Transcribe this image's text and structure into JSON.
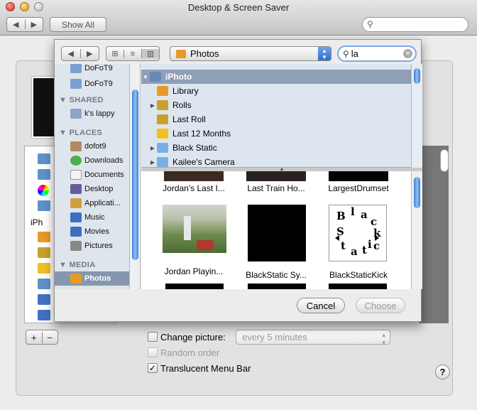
{
  "window": {
    "title": "Desktop & Screen Saver",
    "show_all_label": "Show All"
  },
  "sheet": {
    "location_label": "Photos",
    "search_value": "la",
    "sidebar": {
      "top_items": [
        "DoFoT9",
        "DoFoT9"
      ],
      "shared_header": "SHARED",
      "shared_items": [
        "k's lappy"
      ],
      "places_header": "PLACES",
      "places_items": [
        "dofot9",
        "Downloads",
        "Documents",
        "Desktop",
        "Applicati...",
        "Music",
        "Movies",
        "Pictures"
      ],
      "media_header": "MEDIA",
      "media_items": [
        "Photos"
      ]
    },
    "browser_rows": [
      "iPhoto",
      "Library",
      "Rolls",
      "Last Roll",
      "Last 12 Months",
      "Black Static",
      "Kailee's Camera"
    ],
    "grid_labels": [
      "Jordan's Last I...",
      "Last Train Ho...",
      "LargestDrumset",
      "Jordan Playin...",
      "BlackStatic Sy...",
      "BlackStaticKick"
    ],
    "cancel_label": "Cancel",
    "choose_label": "Choose"
  },
  "background": {
    "list_label": "iPh",
    "change_picture_label": "Change picture:",
    "interval_value": "every 5 minutes",
    "random_order_label": "Random order",
    "translucent_label": "Translucent Menu Bar",
    "help_label": "?"
  },
  "colors": {
    "sidebar_bg": "#dfe5ec",
    "selection": "#8597ae",
    "browser_bg": "#dde6f0",
    "scroll_thumb": "#3b7fd6"
  }
}
